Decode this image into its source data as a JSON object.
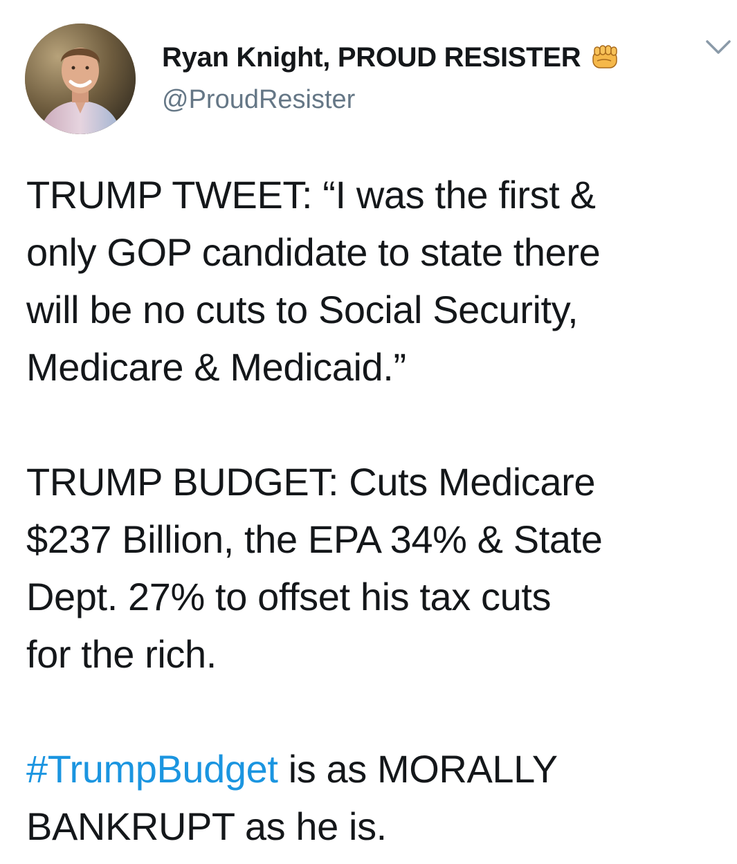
{
  "author": {
    "display_name": "Ryan Knight, PROUD RESISTER",
    "handle": "@ProudResister",
    "badge_icon": "fist-icon",
    "avatar_alt": "profile photo"
  },
  "menu": {
    "icon": "chevron-down-icon"
  },
  "tweet": {
    "paragraph1": [
      "TRUMP TWEET: “I was the first &",
      "only GOP candidate to state there",
      "will be no cuts to Social Security,",
      "Medicare & Medicaid.”"
    ],
    "paragraph2": [
      "TRUMP BUDGET: Cuts Medicare",
      "$237 Billion, the EPA 34% & State",
      "Dept. 27% to offset his tax cuts",
      "for the rich."
    ],
    "paragraph3": {
      "hashtag": "#TrumpBudget",
      "line1_rest": " is as MORALLY",
      "line2": "BANKRUPT as he is."
    }
  },
  "colors": {
    "text": "#14171a",
    "secondary": "#657786",
    "link": "#1b95e0"
  }
}
